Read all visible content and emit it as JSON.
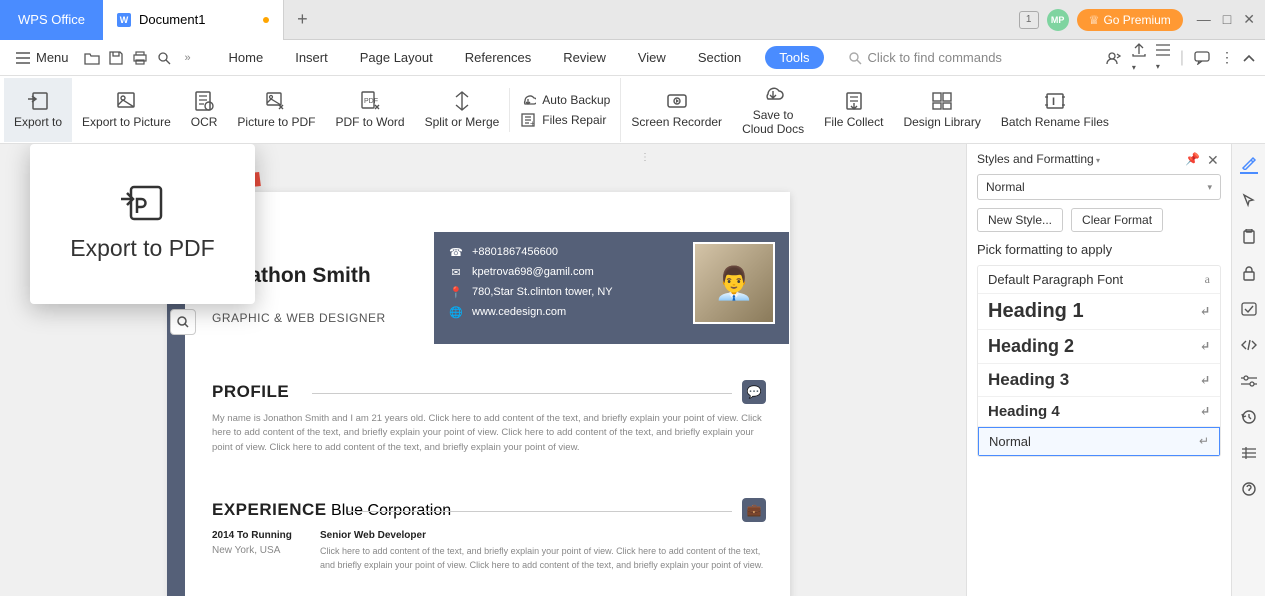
{
  "titlebar": {
    "app_tab": "WPS Office",
    "doc_tab": "Document1",
    "doc_tab_icon_letter": "W",
    "badge_number": "1",
    "avatar_initials": "MP",
    "premium_label": "Go Premium"
  },
  "menubar": {
    "menu_label": "Menu",
    "items": [
      "Home",
      "Insert",
      "Page Layout",
      "References",
      "Review",
      "View",
      "Section",
      "Tools"
    ],
    "active_index": 7,
    "search_placeholder": "Click to find commands"
  },
  "ribbon": {
    "items": [
      {
        "label": "Export to",
        "highlighted": true
      },
      {
        "label": "Export to Picture"
      },
      {
        "label": "OCR"
      },
      {
        "label": "Picture to PDF"
      },
      {
        "label": "PDF to Word"
      },
      {
        "label": "Split or Merge"
      }
    ],
    "group": {
      "row1": "Auto Backup",
      "row2": "Files Repair"
    },
    "items2": [
      {
        "label": "Screen Recorder"
      },
      {
        "label": "Save to\nCloud Docs"
      },
      {
        "label": "File Collect"
      },
      {
        "label": "Design Library"
      },
      {
        "label": "Batch Rename Files"
      }
    ]
  },
  "popup": {
    "text": "Export to PDF"
  },
  "resume": {
    "name": "Jonathon Smith",
    "role": "GRAPHIC & WEB DESIGNER",
    "contact": {
      "phone": "+8801867456600",
      "email": "kpetrova698@gamil.com",
      "address": "780,Star St.clinton tower, NY",
      "website": "www.cedesign.com"
    },
    "profile": {
      "title": "PROFILE",
      "body": "My name is Jonathon Smith and I am 21 years old. Click here to add content of the text, and briefly explain your point of view. Click here to add content of the text, and briefly explain your point of view. Click here to add content of the text, and briefly explain your point of view. Click here to add content of the text, and briefly explain your point of view."
    },
    "experience": {
      "title": "EXPERIENCE",
      "date": "2014 To Running",
      "location": "New York, USA",
      "position": "Senior Web Developer",
      "company": "Blue Corporation",
      "body": "Click here to add content of the text, and briefly explain your point of view. Click here to add content of the text, and briefly explain your point of view. Click here to add content of the text, and briefly explain your point of view."
    }
  },
  "sidepanel": {
    "title": "Styles and Formatting",
    "select_value": "Normal",
    "btn_new": "New Style...",
    "btn_clear": "Clear Format",
    "subheading": "Pick formatting to apply",
    "styles": [
      {
        "name": "Default Paragraph Font",
        "glyph": "a"
      },
      {
        "name": "Heading 1",
        "glyph": "↵",
        "class": "h1"
      },
      {
        "name": "Heading 2",
        "glyph": "↵",
        "class": "h2"
      },
      {
        "name": "Heading 3",
        "glyph": "↵",
        "class": "h3"
      },
      {
        "name": "Heading 4",
        "glyph": "↵",
        "class": "h4"
      },
      {
        "name": "Normal",
        "glyph": "↵",
        "selected": true
      }
    ]
  }
}
